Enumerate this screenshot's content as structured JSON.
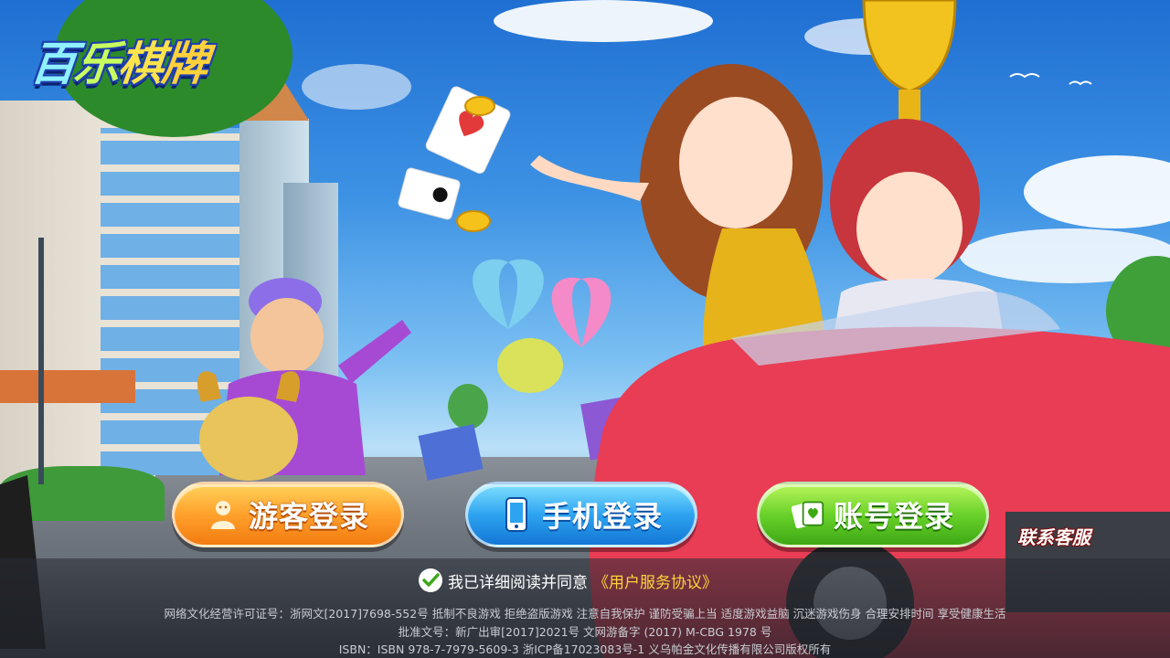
{
  "logo": {
    "chars": [
      "百",
      "乐",
      "棋",
      "牌"
    ]
  },
  "buttons": {
    "guest_label": "游客登录",
    "phone_label": "手机登录",
    "account_label": "账号登录"
  },
  "support_link": "联系客服",
  "agreement": {
    "prefix": "我已详细阅读并同意",
    "link": "《用户服务协议》"
  },
  "legal": {
    "line1": "网络文化经营许可证号：浙网文[2017]7698-552号   抵制不良游戏   拒绝盗版游戏   注意自我保护   谨防受骗上当   适度游戏益脑   沉迷游戏伤身   合理安排时间   享受健康生活",
    "line2": "批准文号：新广出审[2017]2021号 文网游备字 (2017) M-CBG 1978 号",
    "line3": "ISBN：ISBN 978-7-7979-5609-3 浙ICP备17023083号-1 义乌帕金文化传播有限公司版权所有"
  },
  "colors": {
    "guest_button": "#f7931e",
    "phone_button": "#2ea4f0",
    "account_button": "#5cc324",
    "agreement_link": "#ffd23c"
  },
  "icons": {
    "guest": "person-icon",
    "phone": "phone-icon",
    "account": "card-icon",
    "agree": "checkmark-icon"
  }
}
